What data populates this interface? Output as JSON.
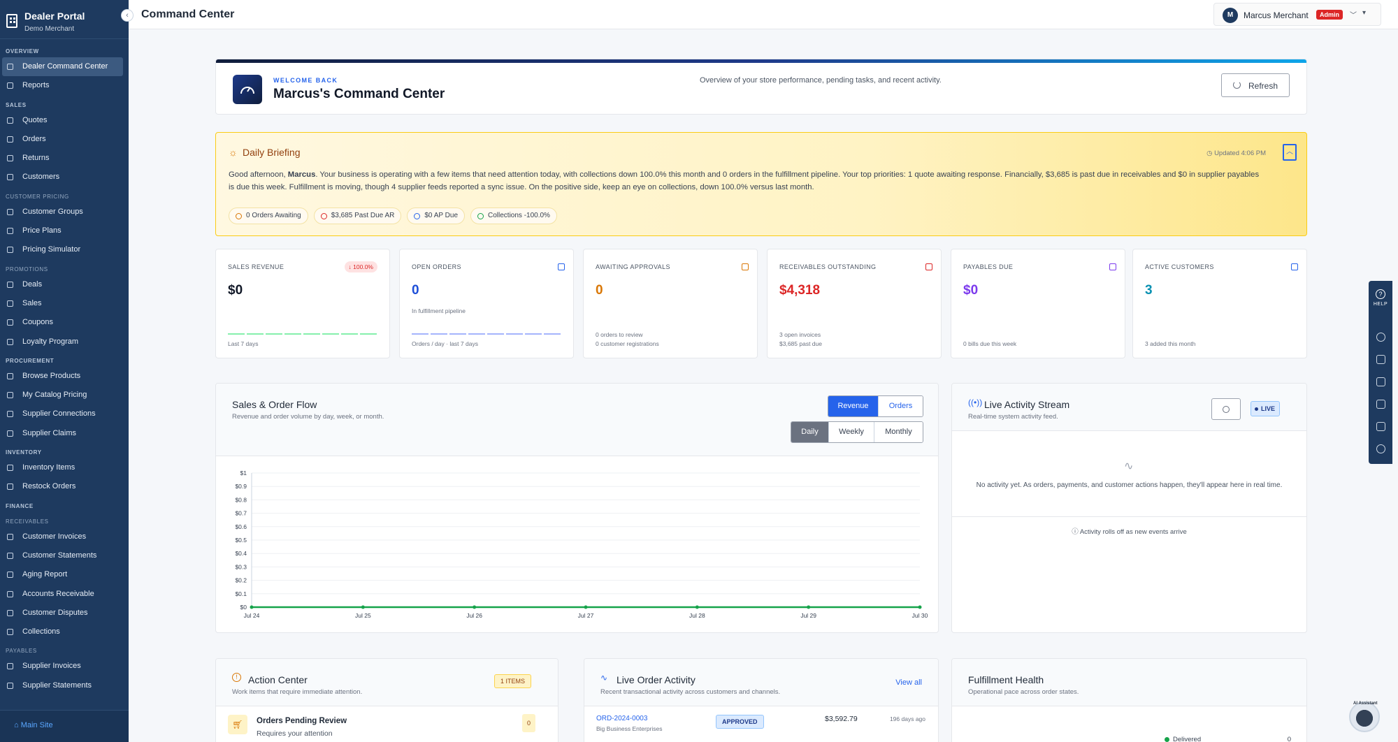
{
  "sidebar": {
    "brand_title": "Dealer Portal",
    "brand_sub": "Demo Merchant",
    "sections": [
      {
        "label": "OVERVIEW",
        "sub": false,
        "items": [
          {
            "label": "Dealer Command Center",
            "active": true,
            "icon": "dashboard-icon"
          },
          {
            "label": "Reports",
            "icon": "chart-icon"
          }
        ]
      },
      {
        "label": "SALES",
        "sub": false,
        "items": [
          {
            "label": "Quotes",
            "icon": "document-icon"
          },
          {
            "label": "Orders",
            "icon": "receipt-icon"
          },
          {
            "label": "Returns",
            "icon": "return-icon"
          },
          {
            "label": "Customers",
            "icon": "users-icon"
          }
        ]
      },
      {
        "label": "CUSTOMER PRICING",
        "sub": true,
        "items": [
          {
            "label": "Customer Groups",
            "icon": "user-group-icon"
          },
          {
            "label": "Price Plans",
            "icon": "dollar-icon"
          },
          {
            "label": "Pricing Simulator",
            "icon": "calculator-icon"
          }
        ]
      },
      {
        "label": "PROMOTIONS",
        "sub": true,
        "items": [
          {
            "label": "Deals",
            "icon": "percent-icon"
          },
          {
            "label": "Sales",
            "icon": "tag-icon"
          },
          {
            "label": "Coupons",
            "icon": "coupon-icon"
          },
          {
            "label": "Loyalty Program",
            "icon": "gift-icon"
          }
        ]
      },
      {
        "label": "PROCUREMENT",
        "sub": false,
        "items": [
          {
            "label": "Browse Products",
            "icon": "grid-icon"
          },
          {
            "label": "My Catalog Pricing",
            "icon": "tag-icon"
          },
          {
            "label": "Supplier Connections",
            "icon": "link-icon"
          },
          {
            "label": "Supplier Claims",
            "icon": "claim-icon"
          }
        ]
      },
      {
        "label": "INVENTORY",
        "sub": false,
        "items": [
          {
            "label": "Inventory Items",
            "icon": "box-icon"
          },
          {
            "label": "Restock Orders",
            "icon": "refresh-icon"
          }
        ]
      },
      {
        "label": "FINANCE",
        "sub": false,
        "items": []
      },
      {
        "label": "RECEIVABLES",
        "sub": true,
        "items": [
          {
            "label": "Customer Invoices",
            "icon": "invoice-icon"
          },
          {
            "label": "Customer Statements",
            "icon": "statement-icon"
          },
          {
            "label": "Aging Report",
            "icon": "clock-icon"
          },
          {
            "label": "Accounts Receivable",
            "icon": "wallet-icon"
          },
          {
            "label": "Customer Disputes",
            "icon": "alert-icon"
          },
          {
            "label": "Collections",
            "icon": "folder-icon"
          }
        ]
      },
      {
        "label": "PAYABLES",
        "sub": true,
        "items": [
          {
            "label": "Supplier Invoices",
            "icon": "invoice-icon"
          },
          {
            "label": "Supplier Statements",
            "icon": "statement-icon"
          }
        ]
      }
    ],
    "main_site": "Main Site"
  },
  "header": {
    "title": "Command Center",
    "user_initial": "M",
    "user_name": "Marcus Merchant",
    "role_badge": "Admin"
  },
  "hero": {
    "welcome": "WELCOME BACK",
    "title": "Marcus's Command Center",
    "description": "Overview of your store performance, pending tasks, and recent activity.",
    "refresh_label": "Refresh"
  },
  "briefing": {
    "title": "Daily Briefing",
    "updated": "Updated 4:06 PM",
    "text_before": "Good afternoon, ",
    "name": "Marcus",
    "text_after": ". Your business is operating with a few items that need attention today, with collections down 100.0% this month and 0 orders in the fulfillment pipeline. Your top priorities: 1 quote awaiting response. Financially, $3,685 is past due in receivables and $0 in supplier payables is due this week. Fulfillment is moving, though 4 supplier feeds reported a sync issue. On the positive side, keep an eye on collections, down 100.0% versus last month.",
    "pills": [
      "0 Orders Awaiting",
      "$3,685 Past Due AR",
      "$0 AP Due",
      "Collections -100.0%"
    ]
  },
  "kpis": [
    {
      "label": "SALES REVENUE",
      "value": "$0",
      "color": "#111827",
      "badge": "↓ 100.0%",
      "sub1": "",
      "sub2": "Last 7 days",
      "spark": "#86efac",
      "icon": ""
    },
    {
      "label": "OPEN ORDERS",
      "value": "0",
      "color": "#1d4ed8",
      "sub0": "In fulfillment pipeline",
      "sub1": "",
      "sub2": "Orders / day · last 7 days",
      "spark": "#a5b4fc",
      "icon": "cube-icon",
      "icolor": "#2563eb"
    },
    {
      "label": "AWAITING APPROVALS",
      "value": "0",
      "color": "#d97706",
      "sub1": "0 orders to review",
      "sub2": "0 customer registrations",
      "icon": "hourglass-icon",
      "icolor": "#d97706"
    },
    {
      "label": "RECEIVABLES OUTSTANDING",
      "value": "$4,318",
      "color": "#dc2626",
      "sub1": "3 open invoices",
      "sub2": "$3,685 past due",
      "icon": "wallet-icon",
      "icolor": "#dc2626"
    },
    {
      "label": "PAYABLES DUE",
      "value": "$0",
      "color": "#7c3aed",
      "sub1": "",
      "sub2": "0 bills due this week",
      "icon": "card-icon",
      "icolor": "#7c3aed"
    },
    {
      "label": "ACTIVE CUSTOMERS",
      "value": "3",
      "color": "#0891b2",
      "sub1": "",
      "sub2": "3 added this month",
      "icon": "users-icon",
      "icolor": "#2563eb"
    }
  ],
  "sales_flow": {
    "title": "Sales & Order Flow",
    "subtitle": "Revenue and order volume by day, week, or month.",
    "metric_tabs": [
      "Revenue",
      "Orders"
    ],
    "period_tabs": [
      "Daily",
      "Weekly",
      "Monthly"
    ]
  },
  "chart_data": {
    "type": "line",
    "x": [
      "Jul 24",
      "Jul 25",
      "Jul 26",
      "Jul 27",
      "Jul 28",
      "Jul 29",
      "Jul 30"
    ],
    "series": [
      {
        "values": [
          0,
          0,
          0,
          0,
          0,
          0,
          0
        ],
        "color": "#16a34a"
      }
    ],
    "y_ticks": [
      "$0",
      "$0.1",
      "$0.2",
      "$0.3",
      "$0.4",
      "$0.5",
      "$0.6",
      "$0.7",
      "$0.8",
      "$0.9",
      "$1"
    ],
    "ylim": [
      0,
      1
    ],
    "grid": true
  },
  "live_stream": {
    "title": "Live Activity Stream",
    "subtitle": "Real-time system activity feed.",
    "live_label": "LIVE",
    "empty_text": "No activity yet. As orders, payments, and customer actions happen, they'll appear here in real time.",
    "footer": "Activity rolls off as new events arrive"
  },
  "action_center": {
    "title": "Action Center",
    "subtitle": "Work items that require immediate attention.",
    "count_badge": "1 ITEMS",
    "row_title": "Orders Pending Review",
    "row_sub": "Requires your attention",
    "row_count": "0"
  },
  "live_orders": {
    "title": "Live Order Activity",
    "subtitle": "Recent transactional activity across customers and channels.",
    "view_all": "View all",
    "order_id": "ORD-2024-0003",
    "customer": "Big Business Enterprises",
    "status": "APPROVED",
    "amount": "$3,592.79",
    "age": "196 days ago"
  },
  "fulfillment": {
    "title": "Fulfillment Health",
    "subtitle": "Operational pace across order states.",
    "row_label": "Delivered",
    "row_value": "0"
  },
  "rail": {
    "help": "HELP"
  },
  "bot": {
    "label": "AI Assistant"
  }
}
